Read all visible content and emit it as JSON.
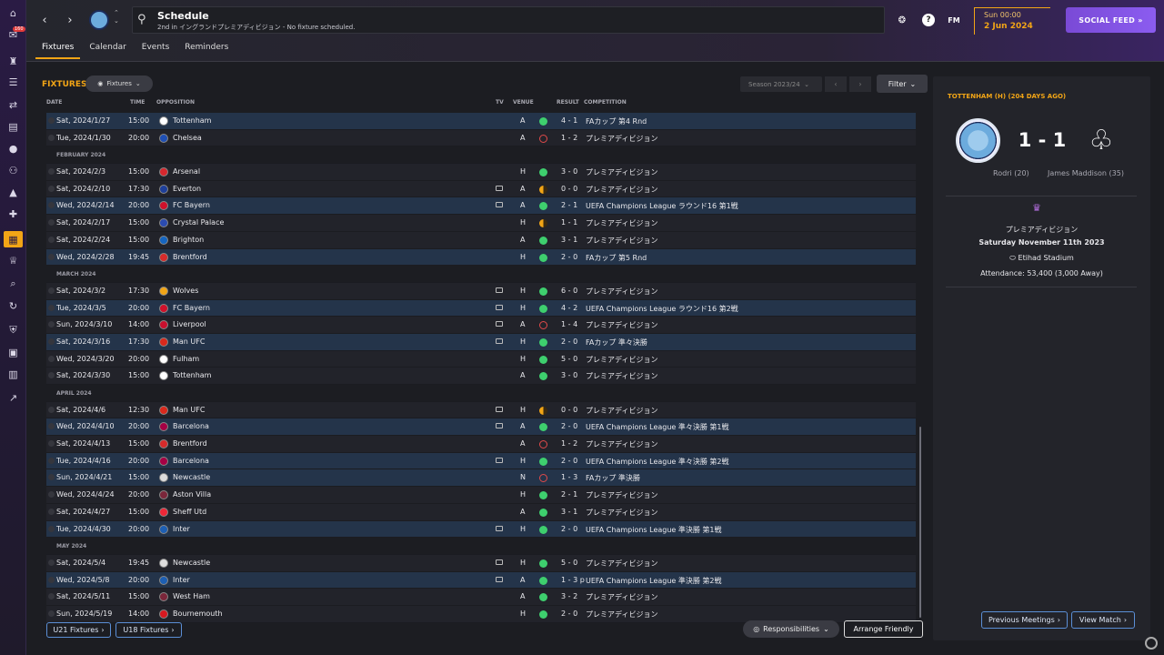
{
  "rail": {
    "badge": "160",
    "icons": [
      "home-icon",
      "inbox-icon",
      "kit-icon",
      "clipboard-icon",
      "transfer-icon",
      "report-icon",
      "ball-icon",
      "people-icon",
      "training-icon",
      "medical-icon",
      "schedule-icon",
      "trophy-icon",
      "scout-icon",
      "swap-icon",
      "shield-icon",
      "briefcase-icon",
      "finance-icon",
      "stats-icon"
    ]
  },
  "header": {
    "title": "Schedule",
    "subtitle": "2nd in イングランドプレミアディビジョン - No fixture scheduled.",
    "fm_label": "FM",
    "help_label": "?",
    "time": "Sun 00:00",
    "date": "2 Jun 2024",
    "social_feed": "SOCIAL FEED",
    "tabs": [
      "Fixtures",
      "Calendar",
      "Events",
      "Reminders"
    ]
  },
  "panel": {
    "title": "FIXTURES",
    "dropdown": "Fixtures",
    "season": "Season 2023/24",
    "filter": "Filter",
    "columns": {
      "date": "DATE",
      "time": "TIME",
      "opposition": "OPPOSITION",
      "tv": "TV",
      "venue": "VENUE",
      "result": "RESULT",
      "competition": "COMPETITION"
    }
  },
  "rows": [
    {
      "type": "match",
      "date": "Sat, 2024/1/27",
      "time": "15:00",
      "opp": "Tottenham",
      "crest": "#ffffff",
      "tv": false,
      "venue": "A",
      "outcome": "w",
      "result": "4 - 1",
      "comp": "FAカップ 第4 Rnd",
      "hl": true
    },
    {
      "type": "match",
      "date": "Tue, 2024/1/30",
      "time": "20:00",
      "opp": "Chelsea",
      "crest": "#1f4fb4",
      "tv": false,
      "venue": "A",
      "outcome": "l",
      "result": "1 - 2",
      "comp": "プレミアディビジョン",
      "hl": false
    },
    {
      "type": "month",
      "label": "FEBRUARY 2024"
    },
    {
      "type": "match",
      "date": "Sat, 2024/2/3",
      "time": "15:00",
      "opp": "Arsenal",
      "crest": "#d6272e",
      "tv": false,
      "venue": "H",
      "outcome": "w",
      "result": "3 - 0",
      "comp": "プレミアディビジョン",
      "hl": false
    },
    {
      "type": "match",
      "date": "Sat, 2024/2/10",
      "time": "17:30",
      "opp": "Everton",
      "crest": "#1e3f9a",
      "tv": true,
      "venue": "A",
      "outcome": "d",
      "result": "0 - 0",
      "comp": "プレミアディビジョン",
      "hl": false
    },
    {
      "type": "match",
      "date": "Wed, 2024/2/14",
      "time": "20:00",
      "opp": "FC Bayern",
      "crest": "#d0112b",
      "tv": true,
      "venue": "A",
      "outcome": "w",
      "result": "2 - 1",
      "comp": "UEFA Champions League ラウンド16 第1戦",
      "hl": true
    },
    {
      "type": "match",
      "date": "Sat, 2024/2/17",
      "time": "15:00",
      "opp": "Crystal Palace",
      "crest": "#2b4bb0",
      "tv": false,
      "venue": "H",
      "outcome": "d",
      "result": "1 - 1",
      "comp": "プレミアディビジョン",
      "hl": false
    },
    {
      "type": "match",
      "date": "Sat, 2024/2/24",
      "time": "15:00",
      "opp": "Brighton",
      "crest": "#1565c0",
      "tv": false,
      "venue": "A",
      "outcome": "w",
      "result": "3 - 1",
      "comp": "プレミアディビジョン",
      "hl": false
    },
    {
      "type": "match",
      "date": "Wed, 2024/2/28",
      "time": "19:45",
      "opp": "Brentford",
      "crest": "#d62b2b",
      "tv": false,
      "venue": "H",
      "outcome": "w",
      "result": "2 - 0",
      "comp": "FAカップ 第5 Rnd",
      "hl": true
    },
    {
      "type": "month",
      "label": "MARCH 2024"
    },
    {
      "type": "match",
      "date": "Sat, 2024/3/2",
      "time": "17:30",
      "opp": "Wolves",
      "crest": "#f2a516",
      "tv": true,
      "venue": "H",
      "outcome": "w",
      "result": "6 - 0",
      "comp": "プレミアディビジョン",
      "hl": false
    },
    {
      "type": "match",
      "date": "Tue, 2024/3/5",
      "time": "20:00",
      "opp": "FC Bayern",
      "crest": "#d0112b",
      "tv": true,
      "venue": "H",
      "outcome": "w",
      "result": "4 - 2",
      "comp": "UEFA Champions League ラウンド16 第2戦",
      "hl": true
    },
    {
      "type": "match",
      "date": "Sun, 2024/3/10",
      "time": "14:00",
      "opp": "Liverpool",
      "crest": "#c8102e",
      "tv": true,
      "venue": "A",
      "outcome": "l",
      "result": "1 - 4",
      "comp": "プレミアディビジョン",
      "hl": false
    },
    {
      "type": "match",
      "date": "Sat, 2024/3/16",
      "time": "17:30",
      "opp": "Man UFC",
      "crest": "#da291c",
      "tv": true,
      "venue": "H",
      "outcome": "w",
      "result": "2 - 0",
      "comp": "FAカップ 準々決勝",
      "hl": true
    },
    {
      "type": "match",
      "date": "Wed, 2024/3/20",
      "time": "20:00",
      "opp": "Fulham",
      "crest": "#ffffff",
      "tv": false,
      "venue": "H",
      "outcome": "w",
      "result": "5 - 0",
      "comp": "プレミアディビジョン",
      "hl": false
    },
    {
      "type": "match",
      "date": "Sat, 2024/3/30",
      "time": "15:00",
      "opp": "Tottenham",
      "crest": "#ffffff",
      "tv": false,
      "venue": "A",
      "outcome": "w",
      "result": "3 - 0",
      "comp": "プレミアディビジョン",
      "hl": false
    },
    {
      "type": "month",
      "label": "APRIL 2024"
    },
    {
      "type": "match",
      "date": "Sat, 2024/4/6",
      "time": "12:30",
      "opp": "Man UFC",
      "crest": "#da291c",
      "tv": true,
      "venue": "H",
      "outcome": "d",
      "result": "0 - 0",
      "comp": "プレミアディビジョン",
      "hl": false
    },
    {
      "type": "match",
      "date": "Wed, 2024/4/10",
      "time": "20:00",
      "opp": "Barcelona",
      "crest": "#a50044",
      "tv": true,
      "venue": "A",
      "outcome": "w",
      "result": "2 - 0",
      "comp": "UEFA Champions League 準々決勝 第1戦",
      "hl": true
    },
    {
      "type": "match",
      "date": "Sat, 2024/4/13",
      "time": "15:00",
      "opp": "Brentford",
      "crest": "#d62b2b",
      "tv": false,
      "venue": "A",
      "outcome": "l",
      "result": "1 - 2",
      "comp": "プレミアディビジョン",
      "hl": false
    },
    {
      "type": "match",
      "date": "Tue, 2024/4/16",
      "time": "20:00",
      "opp": "Barcelona",
      "crest": "#a50044",
      "tv": true,
      "venue": "H",
      "outcome": "w",
      "result": "2 - 0",
      "comp": "UEFA Champions League 準々決勝 第2戦",
      "hl": true
    },
    {
      "type": "match",
      "date": "Sun, 2024/4/21",
      "time": "15:00",
      "opp": "Newcastle",
      "crest": "#dddddd",
      "tv": false,
      "venue": "N",
      "outcome": "l",
      "result": "1 - 3",
      "comp": "FAカップ 準決勝",
      "hl": true
    },
    {
      "type": "match",
      "date": "Wed, 2024/4/24",
      "time": "20:00",
      "opp": "Aston Villa",
      "crest": "#7a263a",
      "tv": false,
      "venue": "H",
      "outcome": "w",
      "result": "2 - 1",
      "comp": "プレミアディビジョン",
      "hl": false
    },
    {
      "type": "match",
      "date": "Sat, 2024/4/27",
      "time": "15:00",
      "opp": "Sheff Utd",
      "crest": "#ee2737",
      "tv": false,
      "venue": "A",
      "outcome": "w",
      "result": "3 - 1",
      "comp": "プレミアディビジョン",
      "hl": false
    },
    {
      "type": "match",
      "date": "Tue, 2024/4/30",
      "time": "20:00",
      "opp": "Inter",
      "crest": "#1d5fb3",
      "tv": true,
      "venue": "H",
      "outcome": "w",
      "result": "2 - 0",
      "comp": "UEFA Champions League 準決勝 第1戦",
      "hl": true
    },
    {
      "type": "month",
      "label": "MAY 2024"
    },
    {
      "type": "match",
      "date": "Sat, 2024/5/4",
      "time": "19:45",
      "opp": "Newcastle",
      "crest": "#dddddd",
      "tv": true,
      "venue": "H",
      "outcome": "w",
      "result": "5 - 0",
      "comp": "プレミアディビジョン",
      "hl": false
    },
    {
      "type": "match",
      "date": "Wed, 2024/5/8",
      "time": "20:00",
      "opp": "Inter",
      "crest": "#1d5fb3",
      "tv": true,
      "venue": "A",
      "outcome": "w",
      "result": "1 - 3 p",
      "comp": "UEFA Champions League 準決勝 第2戦",
      "hl": true
    },
    {
      "type": "match",
      "date": "Sat, 2024/5/11",
      "time": "15:00",
      "opp": "West Ham",
      "crest": "#7a263a",
      "tv": false,
      "venue": "A",
      "outcome": "w",
      "result": "3 - 2",
      "comp": "プレミアディビジョン",
      "hl": false
    },
    {
      "type": "match",
      "date": "Sun, 2024/5/19",
      "time": "14:00",
      "opp": "Bournemouth",
      "crest": "#d71920",
      "tv": false,
      "venue": "H",
      "outcome": "w",
      "result": "2 - 0",
      "comp": "プレミアディビジョン",
      "hl": false
    }
  ],
  "footer": {
    "u21": "U21 Fixtures",
    "u18": "U18 Fixtures",
    "responsibilities": "Responsibilities",
    "arrange": "Arrange Friendly"
  },
  "side": {
    "title": "TOTTENHAM (H) (204 DAYS AGO)",
    "score": "1 - 1",
    "home_scorer": "Rodri (20)",
    "away_scorer": "James Maddison (35)",
    "competition": "プレミアディビジョン",
    "date": "Saturday November 11th 2023",
    "stadium": "Etihad Stadium",
    "attendance": "Attendance: 53,400 (3,000 Away)",
    "prev_meetings": "Previous Meetings",
    "view_match": "View Match"
  },
  "colors": {
    "accent": "#f2a516",
    "win": "#3ecf6e",
    "loss": "#e04a4a",
    "highlight": "#24344a",
    "social": "#8b5cf0"
  }
}
